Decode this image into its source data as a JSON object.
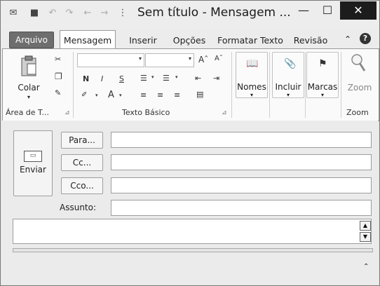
{
  "window": {
    "title": "Sem título - Mensagem ...",
    "minimize_glyph": "—",
    "maximize_glyph": "☐",
    "close_glyph": "✕"
  },
  "quick_access": {
    "icons": [
      "envelope-menu-icon",
      "save-icon",
      "undo-icon",
      "redo-icon",
      "previous-icon",
      "next-icon",
      "customize-toolbar-icon"
    ],
    "glyphs": [
      "✉",
      "■",
      "↶",
      "↷",
      "←",
      "→",
      "⋮"
    ]
  },
  "tabs": {
    "arquivo": "Arquivo",
    "mensagem": "Mensagem",
    "inserir": "Inserir",
    "opcoes": "Opções",
    "formatar": "Formatar Texto",
    "revisao": "Revisão",
    "help": "?",
    "collapse": "⌃"
  },
  "ribbon": {
    "clipboard": {
      "paste": "Colar",
      "paste_arrow": "▾",
      "group_label": "Área de T...",
      "launcher": "⊿"
    },
    "basic_text": {
      "group_label": "Texto Básico",
      "font_arrow": "▾",
      "bold": "N",
      "italic": "I",
      "underline": "S",
      "grow_font": "Aˆ",
      "shrink_font": "Aˇ",
      "font_color": "A",
      "launcher": "⊿"
    },
    "names": {
      "label": "Nomes",
      "arrow": "▾"
    },
    "include": {
      "label": "Incluir",
      "arrow": "▾"
    },
    "tags": {
      "label": "Marcas",
      "arrow": "▾"
    },
    "zoom": {
      "button": "Zoom",
      "group_label": "Zoom"
    }
  },
  "compose": {
    "send": "Enviar",
    "to_button": "Para...",
    "cc_button": "Cc...",
    "bcc_button": "Cco...",
    "subject_label": "Assunto:",
    "to_value": "",
    "cc_value": "",
    "bcc_value": "",
    "subject_value": "",
    "body_value": "",
    "expand": "⌃"
  }
}
